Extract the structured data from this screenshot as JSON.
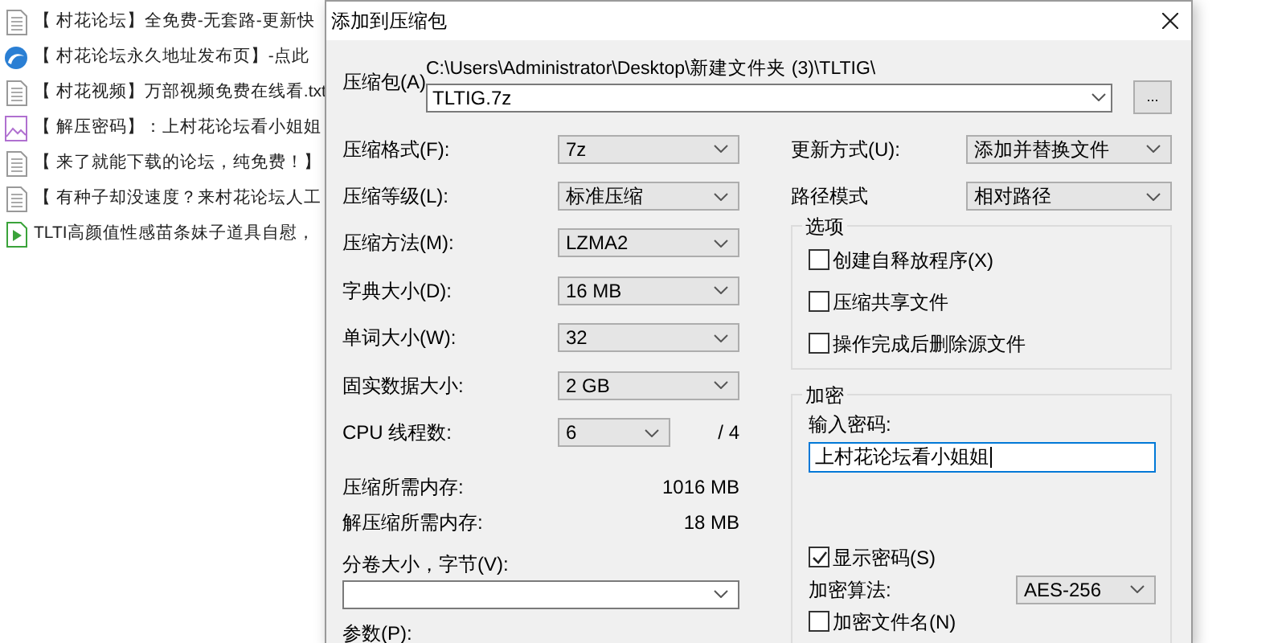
{
  "file_list": [
    {
      "name": "【 村花论坛】全免费-无套路-更新快",
      "kind": "text"
    },
    {
      "name": "【 村花论坛永久地址发布页】-点此",
      "kind": "web"
    },
    {
      "name": "【 村花视频】万部视频免费在线看.txt",
      "kind": "text"
    },
    {
      "name": "【 解压密码】：上村花论坛看小姐姐",
      "kind": "image"
    },
    {
      "name": "【 来了就能下载的论坛，纯免费！】",
      "kind": "text"
    },
    {
      "name": "【 有种子却没速度？来村花论坛人工",
      "kind": "text"
    },
    {
      "name": "TLTI高颜值性感苗条妹子道具自慰，",
      "kind": "video"
    }
  ],
  "dialog": {
    "title": "添加到压缩包",
    "archive": {
      "label": "压缩包(A)",
      "path": "C:\\Users\\Administrator\\Desktop\\新建文件夹 (3)\\TLTIG\\",
      "value": "TLTIG.7z",
      "browse": "..."
    },
    "settings": [
      {
        "kind": "combo",
        "label": "压缩格式(F):",
        "value": "7z"
      },
      {
        "kind": "combo",
        "label": "压缩等级(L):",
        "value": "标准压缩"
      },
      {
        "kind": "combo",
        "label": "压缩方法(M):",
        "value": "LZMA2"
      },
      {
        "kind": "combo",
        "label": "字典大小(D):",
        "value": "16 MB"
      },
      {
        "kind": "combo",
        "label": "单词大小(W):",
        "value": "32"
      },
      {
        "kind": "combo",
        "label": "固实数据大小:",
        "value": "2 GB"
      },
      {
        "kind": "short_combo",
        "label": "CPU 线程数:",
        "value": "6",
        "suffix": "/ 4"
      },
      {
        "kind": "readout",
        "label": "压缩所需内存:",
        "value": "1016 MB"
      },
      {
        "kind": "readout",
        "label": "解压缩所需内存:",
        "value": "18 MB"
      }
    ],
    "volume": {
      "label": "分卷大小，字节(V):"
    },
    "params": {
      "label": "参数(P):"
    },
    "update_mode": {
      "label": "更新方式(U):",
      "value": "添加并替换文件"
    },
    "path_mode": {
      "label": "路径模式",
      "value": "相对路径"
    },
    "options": {
      "title": "选项",
      "items": [
        {
          "label": "创建自释放程序(X)",
          "checked": false
        },
        {
          "label": "压缩共享文件",
          "checked": false
        },
        {
          "label": "操作完成后删除源文件",
          "checked": false
        }
      ]
    },
    "encryption": {
      "title": "加密",
      "password_label": "输入密码:",
      "password": "上村花论坛看小姐姐",
      "show_password": {
        "label": "显示密码(S)",
        "checked": true
      },
      "method": {
        "label": "加密算法:",
        "value": "AES-256"
      },
      "encrypt_names": {
        "label": "加密文件名(N)",
        "checked": false
      }
    }
  }
}
